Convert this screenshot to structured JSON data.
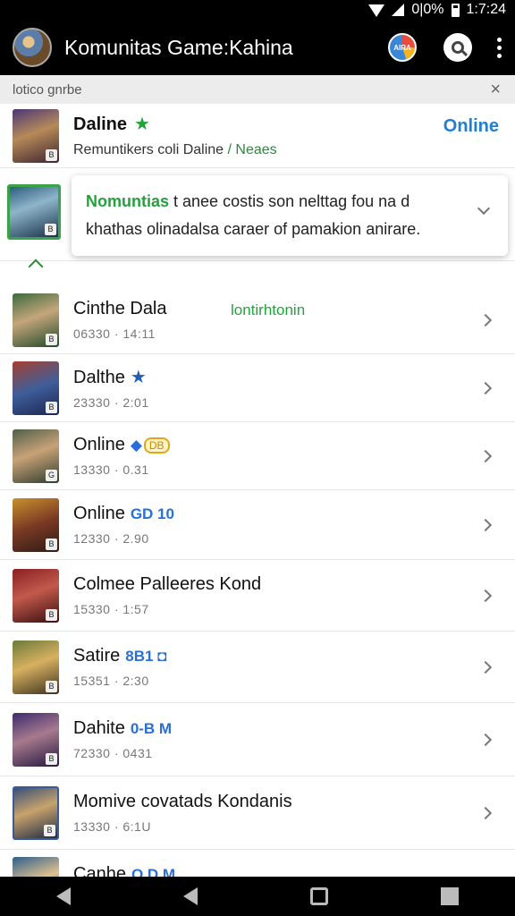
{
  "status_bar": {
    "battery_text": "0|0%",
    "time": "1:7:24"
  },
  "app_bar": {
    "title": "Komunitas Game:Kahina"
  },
  "filter_bar": {
    "label": "lotico gnrbe",
    "close_symbol": "×"
  },
  "first_row": {
    "name": "Daline",
    "subtitle": "Remuntikers coli Daline",
    "subtitle_green": "/ Neaes",
    "status": "Online",
    "thumb_badge": "B"
  },
  "tooltip": {
    "highlight": "Nomuntias",
    "line1": " t anee costis son nelttag fou na d",
    "line2": "khathas olinadalsa caraer of  pamakion anirare.",
    "thumb_badge": "B"
  },
  "rows": [
    {
      "name": "Cinthe Dala",
      "meta": "06330 · 14:11",
      "status_green": "lontirhtonin",
      "badge": "B"
    },
    {
      "name": "Dalthe",
      "meta": "23330 · 2:01",
      "star": "★",
      "badge": "B"
    },
    {
      "name": "Online",
      "meta": "13330 · 0.31",
      "tag_blue": "◆",
      "tag_gold": "DB",
      "badge": "G"
    },
    {
      "name": "Online",
      "meta": "12330 · 2.90",
      "tag_blue": "GD 10",
      "badge": "B"
    },
    {
      "name": "Colmee Palleeres Kond",
      "meta": "15330 · 1:57",
      "badge": "B"
    },
    {
      "name": "Satire",
      "meta": "15351 · 2:30",
      "tag_blue": "8B1 ◘",
      "badge": "B"
    },
    {
      "name": "Dahite",
      "meta": "72330 · 0431",
      "tag_blue": "0-B M",
      "badge": "B"
    },
    {
      "name": "Momive covatads Kondanis",
      "meta": "13330 · 6:1U",
      "badge": "B"
    },
    {
      "name": "Canhe",
      "meta": "",
      "tag_blue": "O.D M",
      "badge": "B"
    }
  ],
  "icons": {
    "star_green": "★",
    "chart_btn": "AIRA"
  },
  "colors": {
    "online_blue": "#1f7fd0",
    "accent_green": "#22a33a",
    "appbar_black": "#000000"
  }
}
